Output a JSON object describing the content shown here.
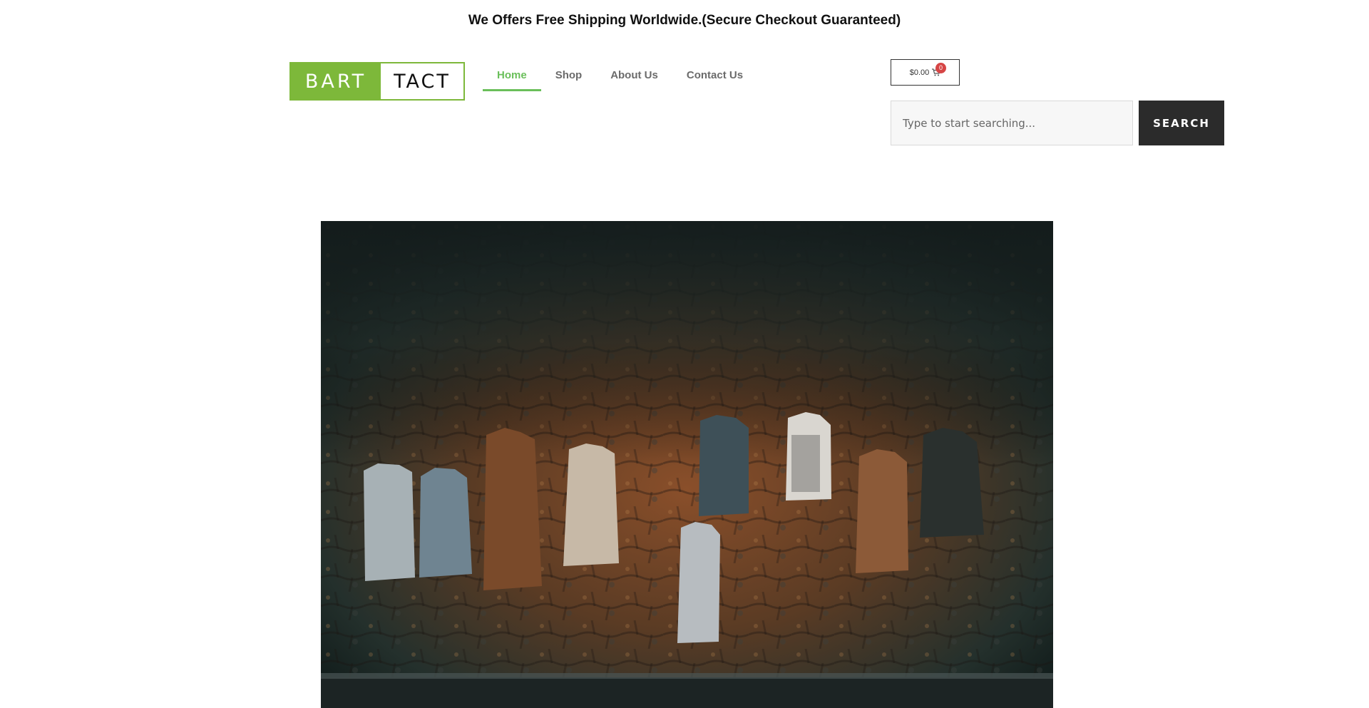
{
  "announcement": {
    "text": "We Offers Free Shipping Worldwide.(Secure Checkout Guaranteed)"
  },
  "logo": {
    "part_a": "BART",
    "part_b": "TACT",
    "brand_color": "#7db83a"
  },
  "nav": {
    "items": [
      {
        "label": "Home",
        "active": true
      },
      {
        "label": "Shop",
        "active": false
      },
      {
        "label": "About Us",
        "active": false
      },
      {
        "label": "Contact Us",
        "active": false
      }
    ],
    "active_color": "#6abf5a"
  },
  "cart": {
    "total": "$0.00",
    "count": "0",
    "icon": "cart-icon",
    "badge_color": "#d64545"
  },
  "search": {
    "placeholder": "Type to start searching...",
    "value": "",
    "button_label": "SEARCH",
    "icon": "none"
  },
  "hero": {
    "image": "clothes-hanging-on-stone-wall-photo"
  }
}
